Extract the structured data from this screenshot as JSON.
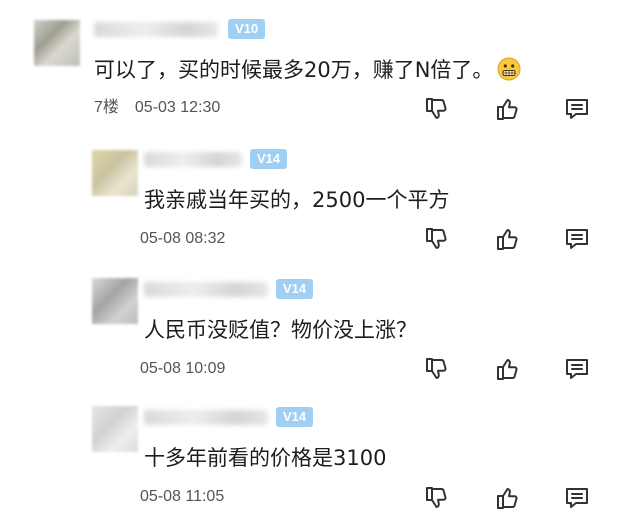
{
  "comments": [
    {
      "badge": "V10",
      "text": "可以了，买的时候最多20万，赚了N倍了。",
      "emoji": "grimace-emoji",
      "floor": "7楼",
      "time": "05-03 12:30"
    },
    {
      "badge": "V14",
      "text": "我亲戚当年买的，2500一个平方",
      "time": "05-08 08:32"
    },
    {
      "badge": "V14",
      "text": "人民币没贬值？物价没上涨？",
      "time": "05-08 10:09"
    },
    {
      "badge": "V14",
      "text": "十多年前看的价格是3100",
      "time": "05-08 11:05"
    }
  ],
  "icons": {
    "dislike": "thumbs-down-icon",
    "like": "thumbs-up-icon",
    "reply": "reply-comment-icon"
  },
  "colors": {
    "badge_bg": "#9fd0f4",
    "text": "#1d1d1d",
    "meta": "#555555",
    "icon": "#333333"
  }
}
